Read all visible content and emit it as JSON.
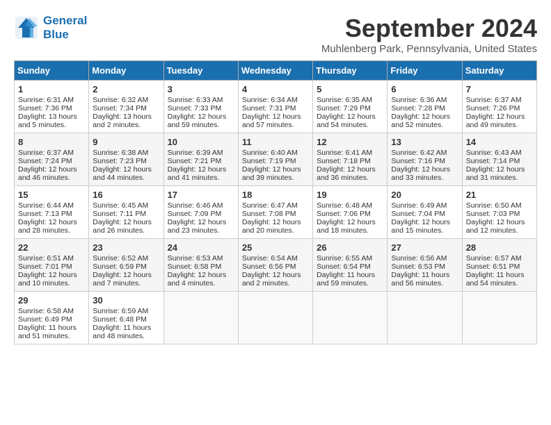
{
  "header": {
    "logo_line1": "General",
    "logo_line2": "Blue",
    "month": "September 2024",
    "location": "Muhlenberg Park, Pennsylvania, United States"
  },
  "days_of_week": [
    "Sunday",
    "Monday",
    "Tuesday",
    "Wednesday",
    "Thursday",
    "Friday",
    "Saturday"
  ],
  "weeks": [
    [
      {
        "num": "1",
        "lines": [
          "Sunrise: 6:31 AM",
          "Sunset: 7:36 PM",
          "Daylight: 13 hours",
          "and 5 minutes."
        ]
      },
      {
        "num": "2",
        "lines": [
          "Sunrise: 6:32 AM",
          "Sunset: 7:34 PM",
          "Daylight: 13 hours",
          "and 2 minutes."
        ]
      },
      {
        "num": "3",
        "lines": [
          "Sunrise: 6:33 AM",
          "Sunset: 7:33 PM",
          "Daylight: 12 hours",
          "and 59 minutes."
        ]
      },
      {
        "num": "4",
        "lines": [
          "Sunrise: 6:34 AM",
          "Sunset: 7:31 PM",
          "Daylight: 12 hours",
          "and 57 minutes."
        ]
      },
      {
        "num": "5",
        "lines": [
          "Sunrise: 6:35 AM",
          "Sunset: 7:29 PM",
          "Daylight: 12 hours",
          "and 54 minutes."
        ]
      },
      {
        "num": "6",
        "lines": [
          "Sunrise: 6:36 AM",
          "Sunset: 7:28 PM",
          "Daylight: 12 hours",
          "and 52 minutes."
        ]
      },
      {
        "num": "7",
        "lines": [
          "Sunrise: 6:37 AM",
          "Sunset: 7:26 PM",
          "Daylight: 12 hours",
          "and 49 minutes."
        ]
      }
    ],
    [
      {
        "num": "8",
        "lines": [
          "Sunrise: 6:37 AM",
          "Sunset: 7:24 PM",
          "Daylight: 12 hours",
          "and 46 minutes."
        ]
      },
      {
        "num": "9",
        "lines": [
          "Sunrise: 6:38 AM",
          "Sunset: 7:23 PM",
          "Daylight: 12 hours",
          "and 44 minutes."
        ]
      },
      {
        "num": "10",
        "lines": [
          "Sunrise: 6:39 AM",
          "Sunset: 7:21 PM",
          "Daylight: 12 hours",
          "and 41 minutes."
        ]
      },
      {
        "num": "11",
        "lines": [
          "Sunrise: 6:40 AM",
          "Sunset: 7:19 PM",
          "Daylight: 12 hours",
          "and 39 minutes."
        ]
      },
      {
        "num": "12",
        "lines": [
          "Sunrise: 6:41 AM",
          "Sunset: 7:18 PM",
          "Daylight: 12 hours",
          "and 36 minutes."
        ]
      },
      {
        "num": "13",
        "lines": [
          "Sunrise: 6:42 AM",
          "Sunset: 7:16 PM",
          "Daylight: 12 hours",
          "and 33 minutes."
        ]
      },
      {
        "num": "14",
        "lines": [
          "Sunrise: 6:43 AM",
          "Sunset: 7:14 PM",
          "Daylight: 12 hours",
          "and 31 minutes."
        ]
      }
    ],
    [
      {
        "num": "15",
        "lines": [
          "Sunrise: 6:44 AM",
          "Sunset: 7:13 PM",
          "Daylight: 12 hours",
          "and 28 minutes."
        ]
      },
      {
        "num": "16",
        "lines": [
          "Sunrise: 6:45 AM",
          "Sunset: 7:11 PM",
          "Daylight: 12 hours",
          "and 26 minutes."
        ]
      },
      {
        "num": "17",
        "lines": [
          "Sunrise: 6:46 AM",
          "Sunset: 7:09 PM",
          "Daylight: 12 hours",
          "and 23 minutes."
        ]
      },
      {
        "num": "18",
        "lines": [
          "Sunrise: 6:47 AM",
          "Sunset: 7:08 PM",
          "Daylight: 12 hours",
          "and 20 minutes."
        ]
      },
      {
        "num": "19",
        "lines": [
          "Sunrise: 6:48 AM",
          "Sunset: 7:06 PM",
          "Daylight: 12 hours",
          "and 18 minutes."
        ]
      },
      {
        "num": "20",
        "lines": [
          "Sunrise: 6:49 AM",
          "Sunset: 7:04 PM",
          "Daylight: 12 hours",
          "and 15 minutes."
        ]
      },
      {
        "num": "21",
        "lines": [
          "Sunrise: 6:50 AM",
          "Sunset: 7:03 PM",
          "Daylight: 12 hours",
          "and 12 minutes."
        ]
      }
    ],
    [
      {
        "num": "22",
        "lines": [
          "Sunrise: 6:51 AM",
          "Sunset: 7:01 PM",
          "Daylight: 12 hours",
          "and 10 minutes."
        ]
      },
      {
        "num": "23",
        "lines": [
          "Sunrise: 6:52 AM",
          "Sunset: 6:59 PM",
          "Daylight: 12 hours",
          "and 7 minutes."
        ]
      },
      {
        "num": "24",
        "lines": [
          "Sunrise: 6:53 AM",
          "Sunset: 6:58 PM",
          "Daylight: 12 hours",
          "and 4 minutes."
        ]
      },
      {
        "num": "25",
        "lines": [
          "Sunrise: 6:54 AM",
          "Sunset: 6:56 PM",
          "Daylight: 12 hours",
          "and 2 minutes."
        ]
      },
      {
        "num": "26",
        "lines": [
          "Sunrise: 6:55 AM",
          "Sunset: 6:54 PM",
          "Daylight: 11 hours",
          "and 59 minutes."
        ]
      },
      {
        "num": "27",
        "lines": [
          "Sunrise: 6:56 AM",
          "Sunset: 6:53 PM",
          "Daylight: 11 hours",
          "and 56 minutes."
        ]
      },
      {
        "num": "28",
        "lines": [
          "Sunrise: 6:57 AM",
          "Sunset: 6:51 PM",
          "Daylight: 11 hours",
          "and 54 minutes."
        ]
      }
    ],
    [
      {
        "num": "29",
        "lines": [
          "Sunrise: 6:58 AM",
          "Sunset: 6:49 PM",
          "Daylight: 11 hours",
          "and 51 minutes."
        ]
      },
      {
        "num": "30",
        "lines": [
          "Sunrise: 6:59 AM",
          "Sunset: 6:48 PM",
          "Daylight: 11 hours",
          "and 48 minutes."
        ]
      },
      null,
      null,
      null,
      null,
      null
    ]
  ]
}
